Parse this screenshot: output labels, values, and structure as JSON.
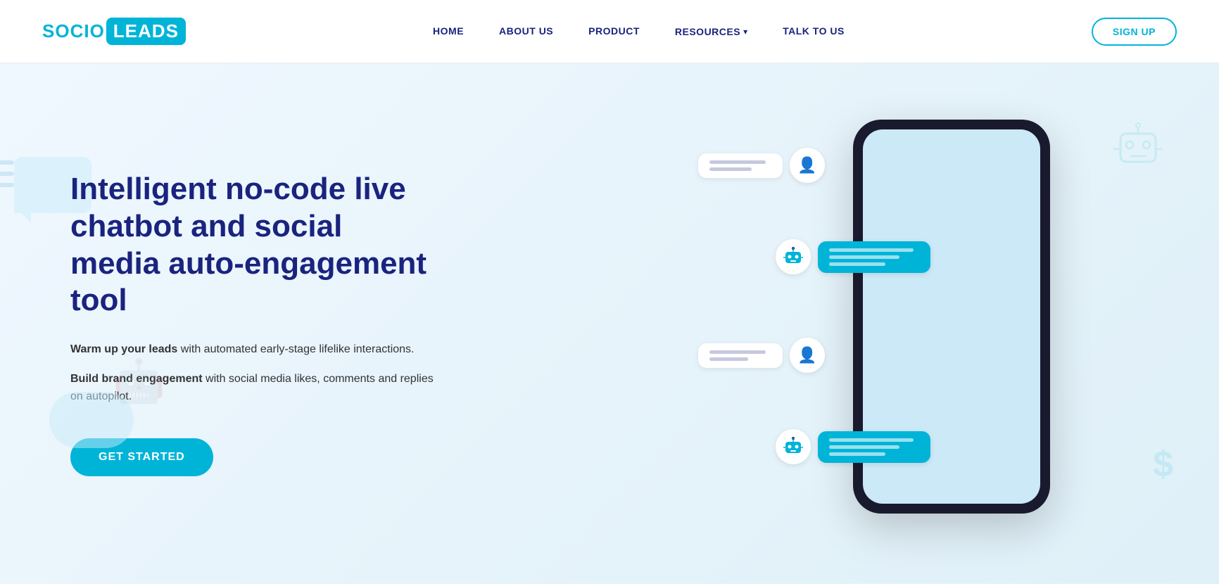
{
  "brand": {
    "name_part1": "SOCIO",
    "name_part2": "LEADS"
  },
  "navbar": {
    "links": [
      {
        "id": "home",
        "label": "HOME"
      },
      {
        "id": "about",
        "label": "ABOUT US"
      },
      {
        "id": "product",
        "label": "PRODUCT"
      },
      {
        "id": "resources",
        "label": "RESOURCES"
      },
      {
        "id": "talk",
        "label": "TALK TO US"
      }
    ],
    "signup_label": "SIGN UP"
  },
  "hero": {
    "title": "Intelligent no-code live chatbot and social media auto-engagement tool",
    "desc1_bold": "Warm up your leads",
    "desc1_rest": " with automated early-stage lifelike interactions.",
    "desc2_bold": "Build brand engagement",
    "desc2_rest": " with social media likes, comments and replies on autopilot.",
    "cta_label": "GET STARTED"
  },
  "colors": {
    "accent": "#00b4d8",
    "navy": "#1a237e",
    "bg_light": "#f0f8ff"
  }
}
